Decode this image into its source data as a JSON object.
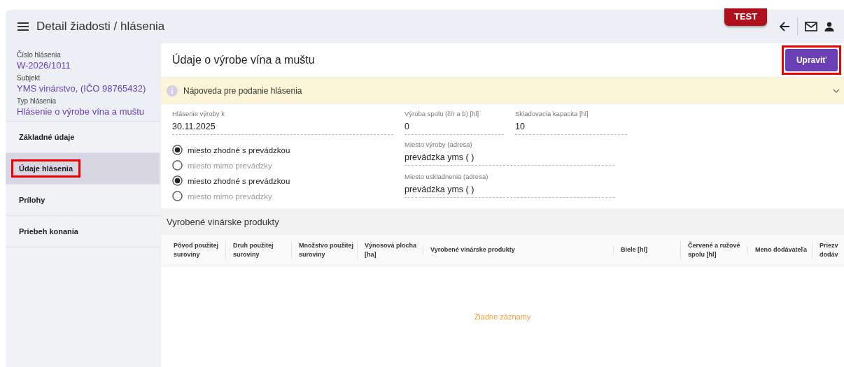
{
  "header": {
    "title": "Detail žiadosti / hlásenia",
    "env_badge": "TEST"
  },
  "sidebar": {
    "info": [
      {
        "label": "Číslo hlásenia",
        "value": "W-2026/1011"
      },
      {
        "label": "Subjekt",
        "value": "YMS vinárstvo, (IČO 98765432)"
      },
      {
        "label": "Typ hlásenia",
        "value": "Hlásenie o výrobe vína a muštu"
      }
    ],
    "items": [
      {
        "label": "Základné údaje",
        "selected": false,
        "highlighted": false
      },
      {
        "label": "Údaje hlásenia",
        "selected": true,
        "highlighted": true
      },
      {
        "label": "Prílohy",
        "selected": false,
        "highlighted": false
      },
      {
        "label": "Priebeh konania",
        "selected": false,
        "highlighted": false
      }
    ]
  },
  "section": {
    "title": "Údaje o výrobe vína a muštu",
    "edit_button": {
      "label": "Upraviť",
      "highlighted": true
    },
    "hint": {
      "text": "Nápoveda pre podanie hlásenia",
      "expanded": false
    }
  },
  "form": {
    "report_date": {
      "label": "Hlásenie výroby k",
      "value": "30.11.2025"
    },
    "production_total": {
      "label": "Výroba spolu (č/r a b) [hl]",
      "value": "0"
    },
    "storage_capacity": {
      "label": "Skladovacia kapacita [hl]",
      "value": "10"
    },
    "radios": [
      {
        "label": "miesto zhodné s prevádzkou",
        "selected": true
      },
      {
        "label": "miesto mimo prevádzky",
        "selected": false
      },
      {
        "label": "miesto zhodné s prevádzkou",
        "selected": true
      },
      {
        "label": "miesto mimo prevádzky",
        "selected": false
      }
    ],
    "production_place": {
      "label": "Miesto výroby (adresa)",
      "value": "prevádzka yms ( )"
    },
    "storage_place": {
      "label": "Miesto uskladnenia (adresa)",
      "value": "prevádzka yms ( )"
    }
  },
  "table": {
    "title": "Vyrobené vinárske produkty",
    "columns": [
      "Pôvod použitej suroviny",
      "Druh použitej suroviny",
      "Množstvo použitej suroviny",
      "Výnosová plocha [ha]",
      "Vyrobené vinárske produkty",
      "Biele [hl]",
      "Červené a ružové spolu [hl]",
      "Meno dodávateľa",
      "Priezv dodáv"
    ],
    "empty_text": "Žiadne záznamy"
  }
}
